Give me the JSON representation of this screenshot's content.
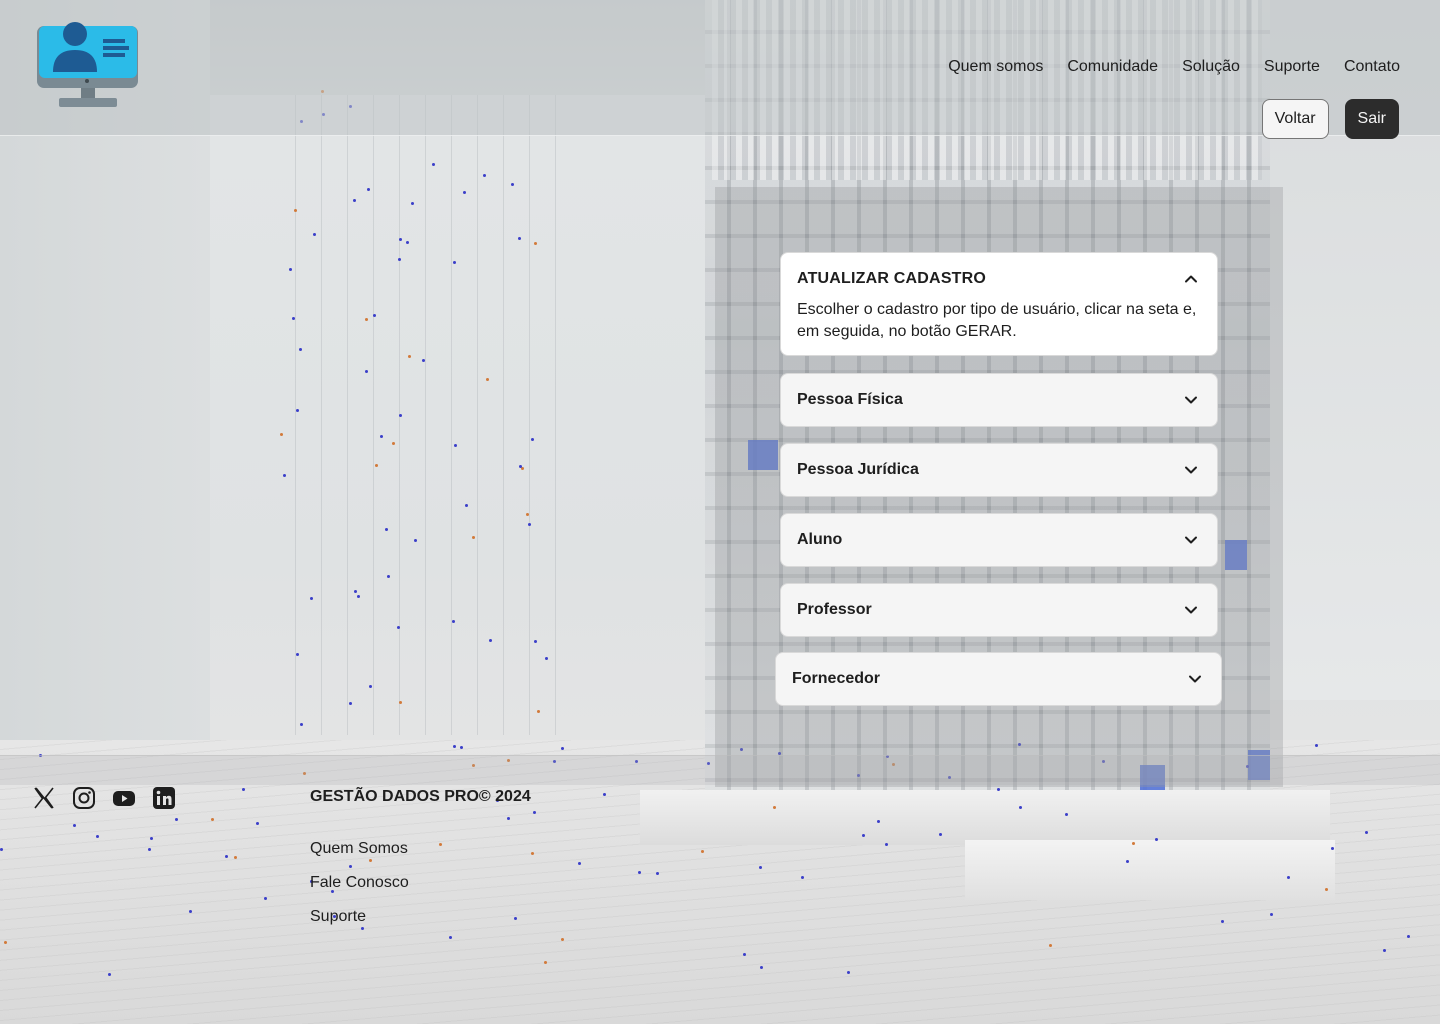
{
  "brand": {
    "logo_icon": "computer-user-icon",
    "colors": {
      "logo_screen": "#29b6e6",
      "logo_user": "#1f5f99",
      "logo_stand": "#7a8a93"
    }
  },
  "header": {
    "nav": [
      "Quem somos",
      "Comunidade",
      "Solução",
      "Suporte",
      "Contato"
    ],
    "back_label": "Voltar",
    "exit_label": "Sair"
  },
  "main": {
    "intro": {
      "title": "ATUALIZAR CADASTRO",
      "description": "Escolher o cadastro por tipo de usuário, clicar na seta e, em seguida, no botão GERAR.",
      "icon": "chevron-up-icon"
    },
    "options": [
      {
        "label": "Pessoa Física",
        "icon": "chevron-down-icon"
      },
      {
        "label": "Pessoa Jurídica",
        "icon": "chevron-down-icon"
      },
      {
        "label": "Aluno",
        "icon": "chevron-down-icon"
      },
      {
        "label": "Professor",
        "icon": "chevron-down-icon"
      },
      {
        "label": "Fornecedor",
        "icon": "chevron-down-icon"
      }
    ]
  },
  "footer": {
    "social": [
      "x-icon",
      "instagram-icon",
      "youtube-icon",
      "linkedin-icon"
    ],
    "title": "GESTÃO DADOS PRO© 2024",
    "links": [
      "Quem Somos",
      "Fale Conosco",
      "Suporte"
    ]
  },
  "colors": {
    "dark_button": "#2c2c2c",
    "card": "#f5f5f5",
    "text": "#1e1e1e"
  }
}
